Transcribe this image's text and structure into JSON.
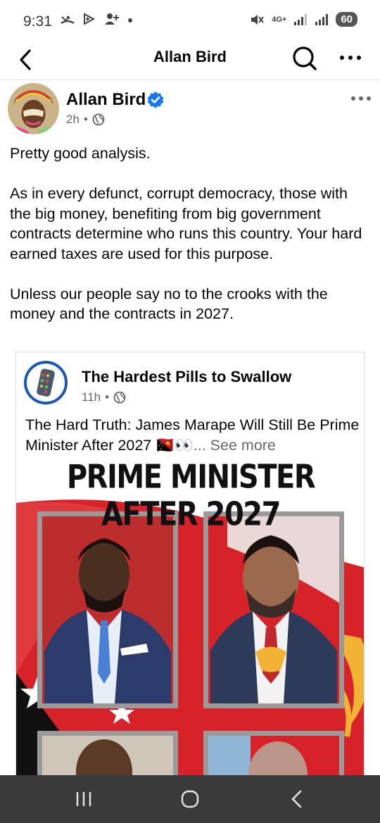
{
  "status_bar": {
    "time": "9:31",
    "left_icons": [
      "missed-call-icon",
      "media-icon",
      "add-user-icon",
      "dot-icon"
    ],
    "signal_label": "4G+",
    "battery": "60"
  },
  "app_bar": {
    "title": "Allan Bird"
  },
  "post": {
    "author": "Allan Bird",
    "verified": true,
    "time": "2h",
    "separator": "•",
    "paragraphs": [
      "Pretty good analysis.",
      "As in every defunct, corrupt democracy, those with the big money, benefiting from big government contracts determine who runs this country. Your hard earned taxes are used for this purpose.",
      "Unless our people say no to the crooks with the money and the contracts in 2027."
    ]
  },
  "shared": {
    "page_name": "The Hardest Pills to Swallow",
    "time": "11h",
    "separator": "•",
    "text": "The Hard Truth: James Marape Will Still Be Prime Minister After 2027 🇵🇬👀",
    "see_more": "... See more",
    "image_headline": "PRIME MINISTER AFTER 2027"
  },
  "colors": {
    "accent": "#1877f2",
    "flag_red": "#d8222a",
    "flag_black": "#111111",
    "gold": "#f2b233",
    "nav_bg": "#3a3a3a"
  }
}
